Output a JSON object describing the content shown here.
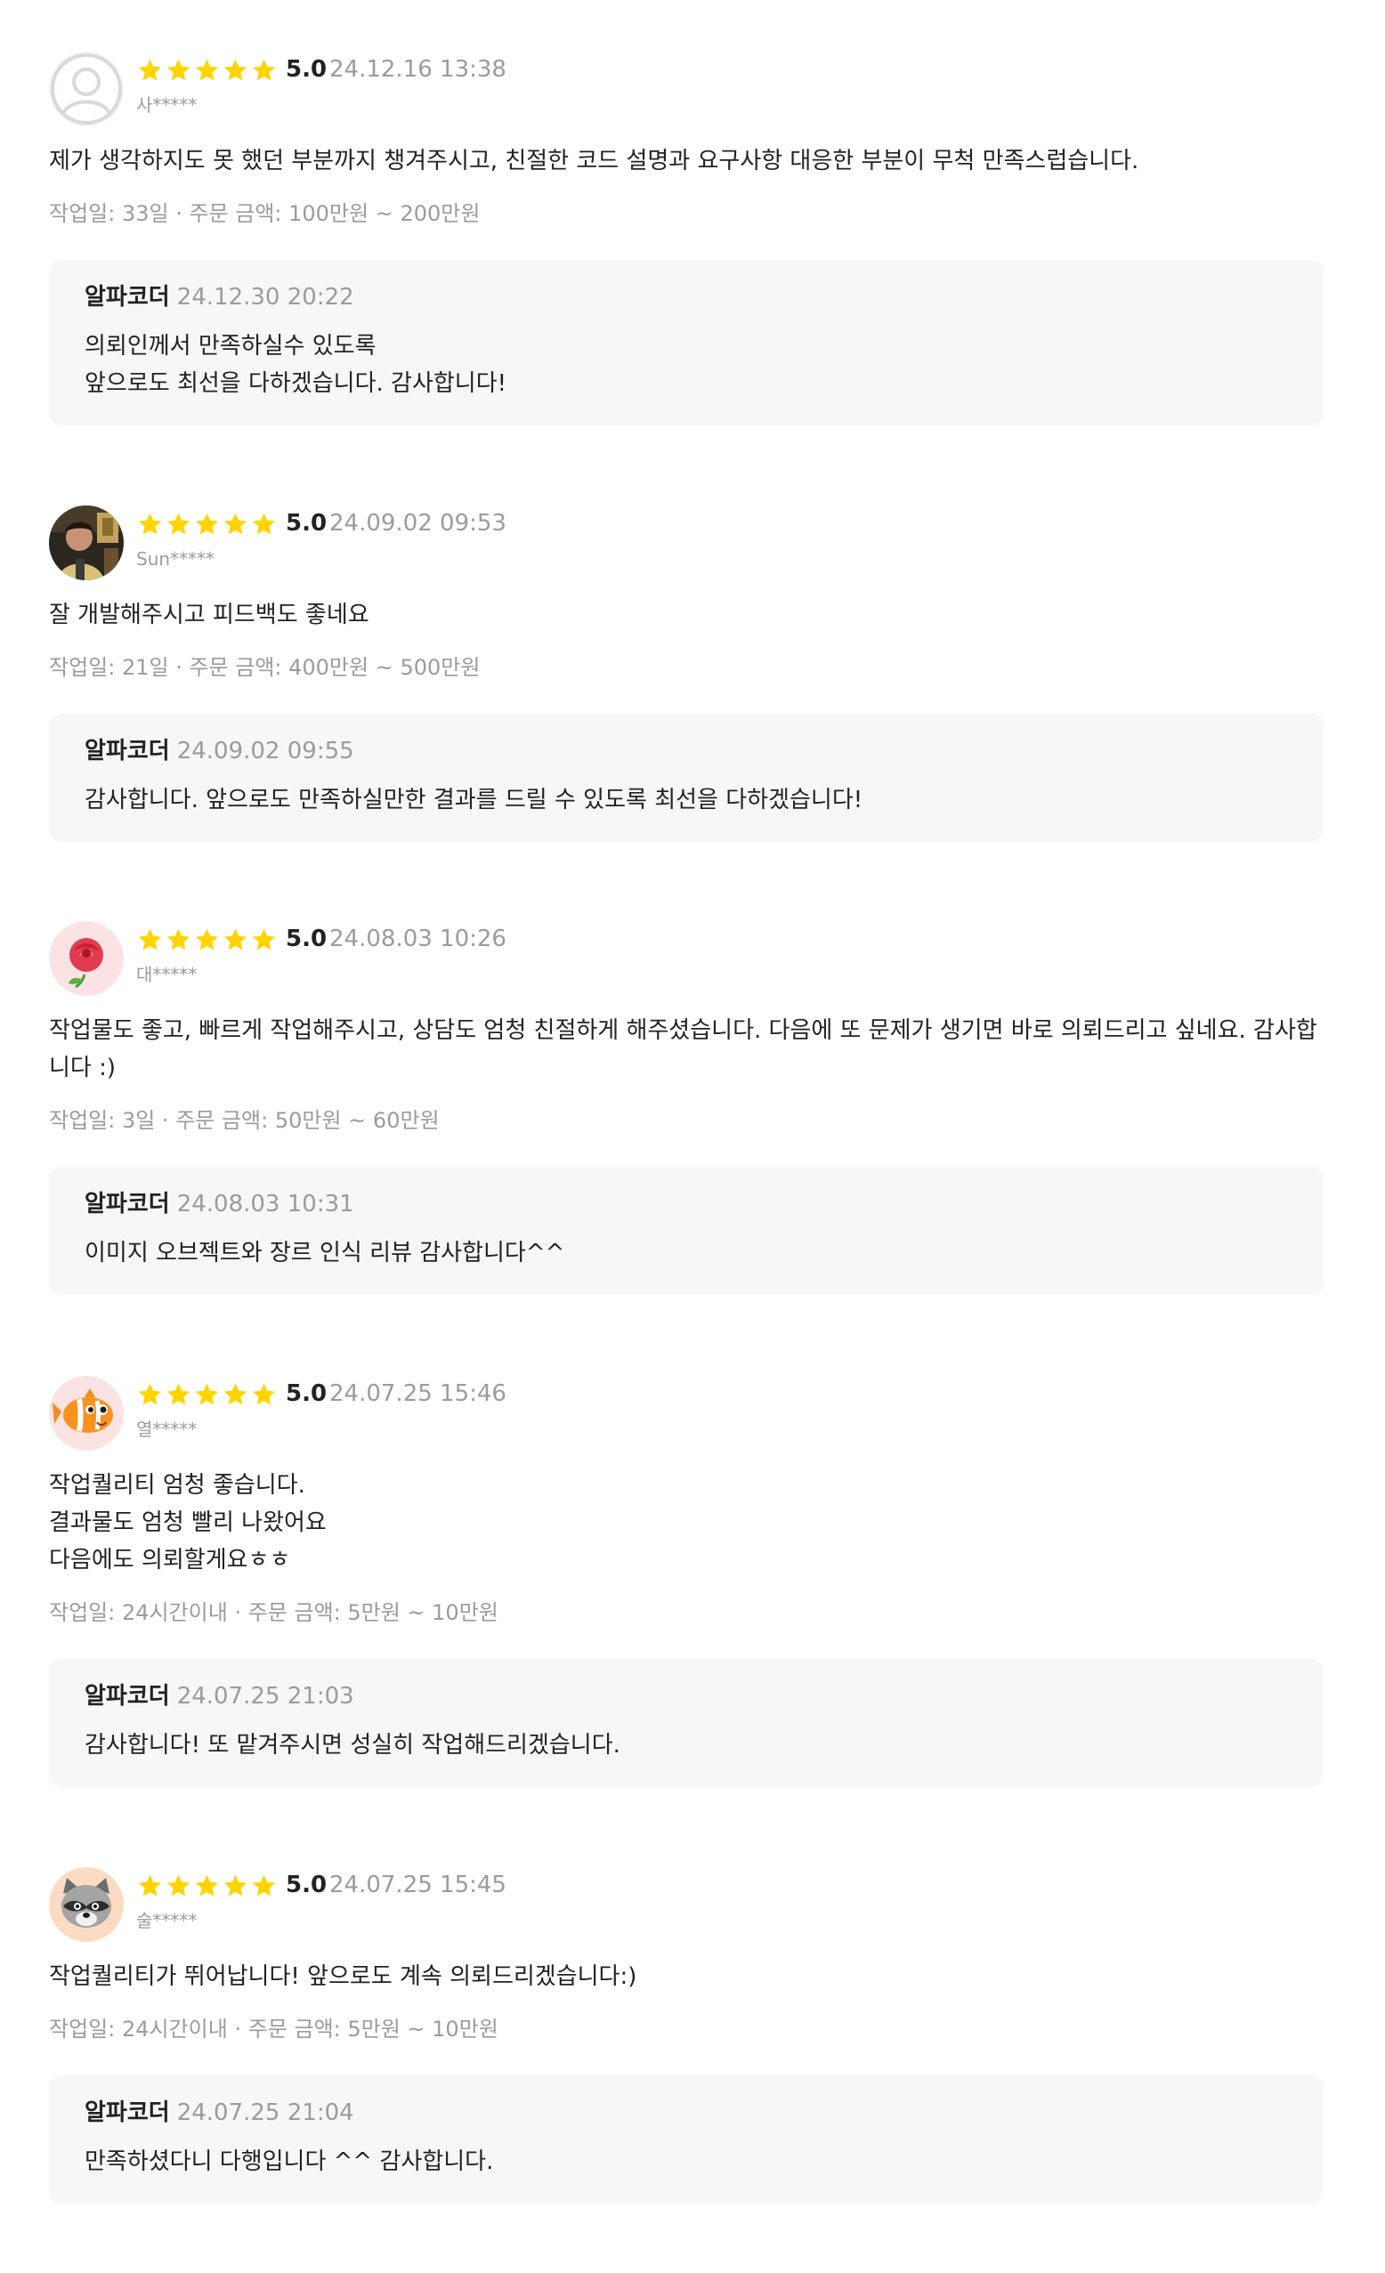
{
  "reviews": [
    {
      "rating": "5.0",
      "date": "24.12.16 13:38",
      "nickname": "사*****",
      "avatar_icon": "default-user-icon",
      "content": "제가 생각하지도 못 했던 부분까지 챙겨주시고, 친절한 코드 설명과 요구사항 대응한 부분이 무척 만족스럽습니다.",
      "meta": "작업일: 33일 · 주문 금액: 100만원 ~ 200만원",
      "reply": {
        "name": "알파코더",
        "date": "24.12.30 20:22",
        "text": "의뢰인께서 만족하실수 있도록\n앞으로도 최선을 다하겠습니다. 감사합니다!"
      }
    },
    {
      "rating": "5.0",
      "date": "24.09.02 09:53",
      "nickname": "Sun*****",
      "avatar_icon": "user-photo",
      "content": "잘 개발해주시고 피드백도 좋네요",
      "meta": "작업일: 21일 · 주문 금액: 400만원 ~ 500만원",
      "reply": {
        "name": "알파코더",
        "date": "24.09.02 09:55",
        "text": "감사합니다. 앞으로도 만족하실만한 결과를 드릴 수 있도록 최선을 다하겠습니다!"
      }
    },
    {
      "rating": "5.0",
      "date": "24.08.03 10:26",
      "nickname": "대*****",
      "avatar_icon": "rose-icon",
      "content": "작업물도 좋고, 빠르게 작업해주시고, 상담도 엄청 친절하게 해주셨습니다. 다음에 또 문제가 생기면 바로 의뢰드리고 싶네요. 감사합니다 :)",
      "meta": "작업일: 3일 · 주문 금액: 50만원 ~ 60만원",
      "reply": {
        "name": "알파코더",
        "date": "24.08.03 10:31",
        "text": "이미지 오브젝트와 장르 인식 리뷰 감사합니다^^"
      }
    },
    {
      "rating": "5.0",
      "date": "24.07.25 15:46",
      "nickname": "열*****",
      "avatar_icon": "clownfish-icon",
      "content": "작업퀄리티 엄청 좋습니다.\n결과물도 엄청 빨리 나왔어요\n다음에도 의뢰할게요ㅎㅎ",
      "meta": "작업일: 24시간이내 · 주문 금액: 5만원 ~ 10만원",
      "reply": {
        "name": "알파코더",
        "date": "24.07.25 21:03",
        "text": "감사합니다! 또 맡겨주시면 성실히 작업해드리겠습니다."
      }
    },
    {
      "rating": "5.0",
      "date": "24.07.25 15:45",
      "nickname": "술*****",
      "avatar_icon": "raccoon-icon",
      "content": "작업퀄리티가 뛰어납니다! 앞으로도 계속 의뢰드리겠습니다:)",
      "meta": "작업일: 24시간이내 · 주문 금액: 5만원 ~ 10만원",
      "reply": {
        "name": "알파코더",
        "date": "24.07.25 21:04",
        "text": "만족하셨다니 다행입니다 ^^ 감사합니다."
      }
    }
  ],
  "colors": {
    "star": "#FFD400",
    "muted": "#9a9ba0",
    "reply_bg": "#f7f7f8"
  }
}
